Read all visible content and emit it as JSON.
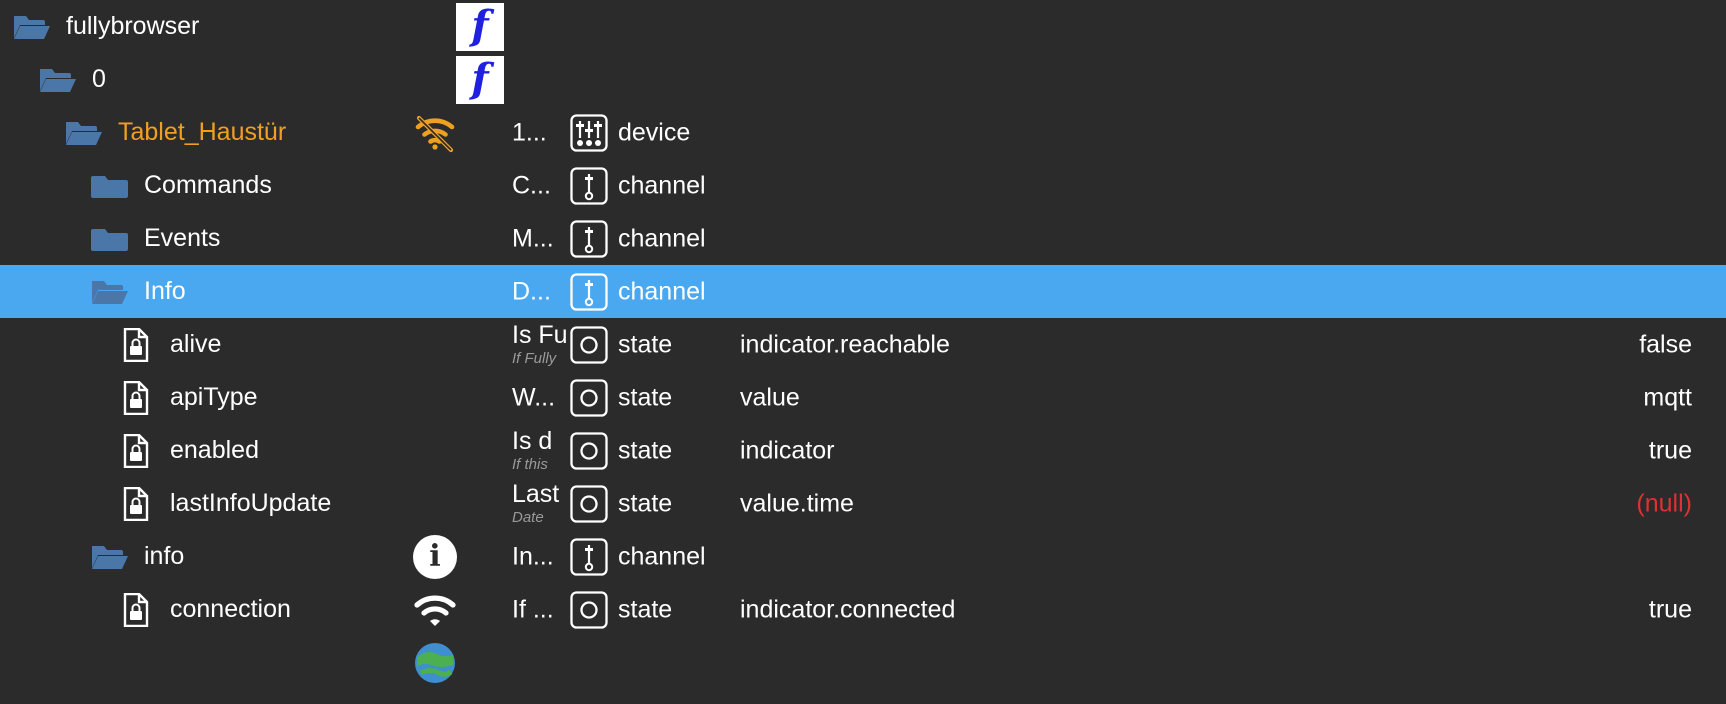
{
  "theme": {
    "background": "#2b2b2b",
    "selection": "#4aa8f0",
    "folder": "#4a77a8",
    "accent_text": "#f0a020",
    "null_value": "#e03030",
    "text": "#ffffff",
    "subtext": "#9a9a9a",
    "favicon_glyph": "f",
    "favicon_color": "#2020e0"
  },
  "rows": [
    {
      "name": "fullybrowser",
      "icon": "folder-open-icon",
      "indent": 0,
      "selected": false,
      "status_icon": "",
      "favicon": "f",
      "desc_title": "",
      "desc_sub": "",
      "type_icon": "",
      "type_label": "",
      "role": "",
      "value": ""
    },
    {
      "name": "0",
      "icon": "folder-open-icon",
      "indent": 1,
      "selected": false,
      "status_icon": "",
      "favicon": "f",
      "desc_title": "",
      "desc_sub": "",
      "type_icon": "",
      "type_label": "",
      "role": "",
      "value": ""
    },
    {
      "name": "Tablet_Haustür",
      "icon": "folder-open-icon",
      "indent": 2,
      "selected": false,
      "accent": true,
      "status_icon": "wifi-off-icon",
      "favicon": "",
      "desc_title": "1...",
      "desc_sub": "",
      "type_icon": "device-icon",
      "type_label": "device",
      "role": "",
      "value": ""
    },
    {
      "name": "Commands",
      "icon": "folder-closed-icon",
      "indent": 3,
      "selected": false,
      "status_icon": "",
      "favicon": "",
      "desc_title": "C...",
      "desc_sub": "",
      "type_icon": "channel-icon",
      "type_label": "channel",
      "role": "",
      "value": ""
    },
    {
      "name": "Events",
      "icon": "folder-closed-icon",
      "indent": 3,
      "selected": false,
      "status_icon": "",
      "favicon": "",
      "desc_title": "M...",
      "desc_sub": "",
      "type_icon": "channel-icon",
      "type_label": "channel",
      "role": "",
      "value": ""
    },
    {
      "name": "Info",
      "icon": "folder-open-icon",
      "indent": 3,
      "selected": true,
      "status_icon": "",
      "favicon": "",
      "desc_title": "D...",
      "desc_sub": "",
      "type_icon": "channel-icon",
      "type_label": "channel",
      "role": "",
      "value": ""
    },
    {
      "name": "alive",
      "icon": "doc-lock-icon",
      "indent": 4,
      "selected": false,
      "status_icon": "",
      "favicon": "",
      "desc_title": "Is Fu",
      "desc_sub": "If Fully",
      "type_icon": "state-icon",
      "type_label": "state",
      "role": "indicator.reachable",
      "value": "false"
    },
    {
      "name": "apiType",
      "icon": "doc-lock-icon",
      "indent": 4,
      "selected": false,
      "status_icon": "",
      "favicon": "",
      "desc_title": "W...",
      "desc_sub": "",
      "type_icon": "state-icon",
      "type_label": "state",
      "role": "value",
      "value": "mqtt"
    },
    {
      "name": "enabled",
      "icon": "doc-lock-icon",
      "indent": 4,
      "selected": false,
      "status_icon": "",
      "favicon": "",
      "desc_title": "Is d",
      "desc_sub": "If this",
      "type_icon": "state-icon",
      "type_label": "state",
      "role": "indicator",
      "value": "true"
    },
    {
      "name": "lastInfoUpdate",
      "icon": "doc-lock-icon",
      "indent": 4,
      "selected": false,
      "status_icon": "",
      "favicon": "",
      "desc_title": "Last",
      "desc_sub": "Date",
      "type_icon": "state-icon",
      "type_label": "state",
      "role": "value.time",
      "value": "(null)",
      "value_null": true
    },
    {
      "name": "info",
      "icon": "folder-open-icon",
      "indent": 3,
      "selected": false,
      "status_icon": "info-icon",
      "favicon": "",
      "desc_title": "In...",
      "desc_sub": "",
      "type_icon": "channel-icon",
      "type_label": "channel",
      "role": "",
      "value": ""
    },
    {
      "name": "connection",
      "icon": "doc-lock-icon",
      "indent": 4,
      "selected": false,
      "status_icon": "wifi-icon",
      "favicon": "",
      "desc_title": "If ...",
      "desc_sub": "",
      "type_icon": "state-icon",
      "type_label": "state",
      "role": "indicator.connected",
      "value": "true"
    }
  ],
  "partial_row": {
    "status_icon": "globe-icon"
  }
}
